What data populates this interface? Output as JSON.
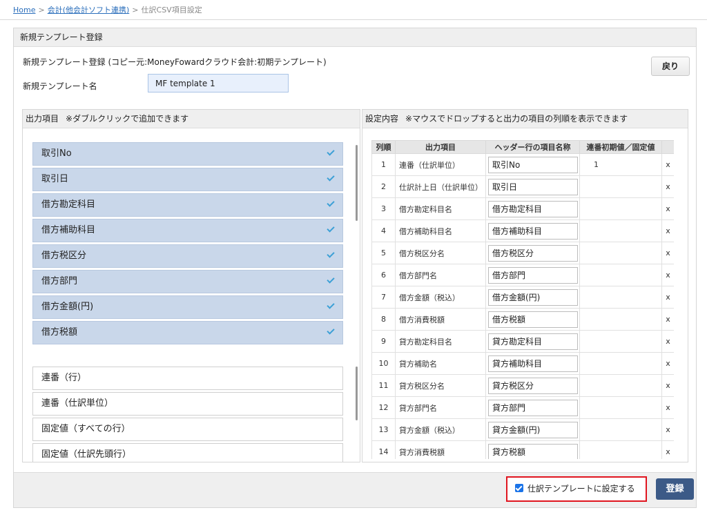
{
  "breadcrumb": {
    "home": "Home",
    "accounting": "会計(他会計ソフト連携)",
    "current": "仕訳CSV項目設定",
    "separator": ">"
  },
  "panel": {
    "title": "新規テンプレート登録",
    "subtitle": "新規テンプレート登録 (コピー元:MoneyFowardクラウド会計:初期テンプレート)",
    "back_label": "戻り",
    "name_label": "新規テンプレート名",
    "name_value": "MF template 1"
  },
  "left": {
    "title": "出力項目",
    "hint": "※ダブルクリックで追加できます",
    "selected": [
      "取引No",
      "取引日",
      "借方勘定科目",
      "借方補助科目",
      "借方税区分",
      "借方部門",
      "借方金額(円)",
      "借方税額"
    ],
    "available": [
      "連番（行）",
      "連番（仕訳単位）",
      "固定値（すべての行）",
      "固定値（仕訳先頭行）"
    ]
  },
  "right": {
    "title": "設定内容",
    "hint": "※マウスでドロップすると出力の項目の列順を表示できます",
    "columns": [
      "列順",
      "出力項目",
      "ヘッダー行の項目名称",
      "連番初期値／固定値"
    ],
    "delete_label": "x",
    "rows": [
      {
        "no": "1",
        "item": "連番（仕訳単位）",
        "header": "取引No",
        "init": "1"
      },
      {
        "no": "2",
        "item": "仕訳計上日（仕訳単位）",
        "header": "取引日",
        "init": ""
      },
      {
        "no": "3",
        "item": "借方勘定科目名",
        "header": "借方勘定科目",
        "init": ""
      },
      {
        "no": "4",
        "item": "借方補助科目名",
        "header": "借方補助科目",
        "init": ""
      },
      {
        "no": "5",
        "item": "借方税区分名",
        "header": "借方税区分",
        "init": ""
      },
      {
        "no": "6",
        "item": "借方部門名",
        "header": "借方部門",
        "init": ""
      },
      {
        "no": "7",
        "item": "借方金額（税込）",
        "header": "借方金額(円)",
        "init": ""
      },
      {
        "no": "8",
        "item": "借方消費税額",
        "header": "借方税額",
        "init": ""
      },
      {
        "no": "9",
        "item": "貸方勘定科目名",
        "header": "貸方勘定科目",
        "init": ""
      },
      {
        "no": "10",
        "item": "貸方補助名",
        "header": "貸方補助科目",
        "init": ""
      },
      {
        "no": "11",
        "item": "貸方税区分名",
        "header": "貸方税区分",
        "init": ""
      },
      {
        "no": "12",
        "item": "貸方部門名",
        "header": "貸方部門",
        "init": ""
      },
      {
        "no": "13",
        "item": "貸方金額（税込）",
        "header": "貸方金額(円)",
        "init": ""
      },
      {
        "no": "14",
        "item": "貸方消費税額",
        "header": "貸方税額",
        "init": ""
      }
    ]
  },
  "footer": {
    "set_template_label": "仕訳テンプレートに設定する",
    "set_template_checked": true,
    "register_label": "登録"
  },
  "colors": {
    "selected_bg": "#c9d7ea",
    "check": "#3da0d6",
    "register_bg": "#3c5a87",
    "highlight_border": "#e0141e",
    "link": "#2a6ebb"
  }
}
